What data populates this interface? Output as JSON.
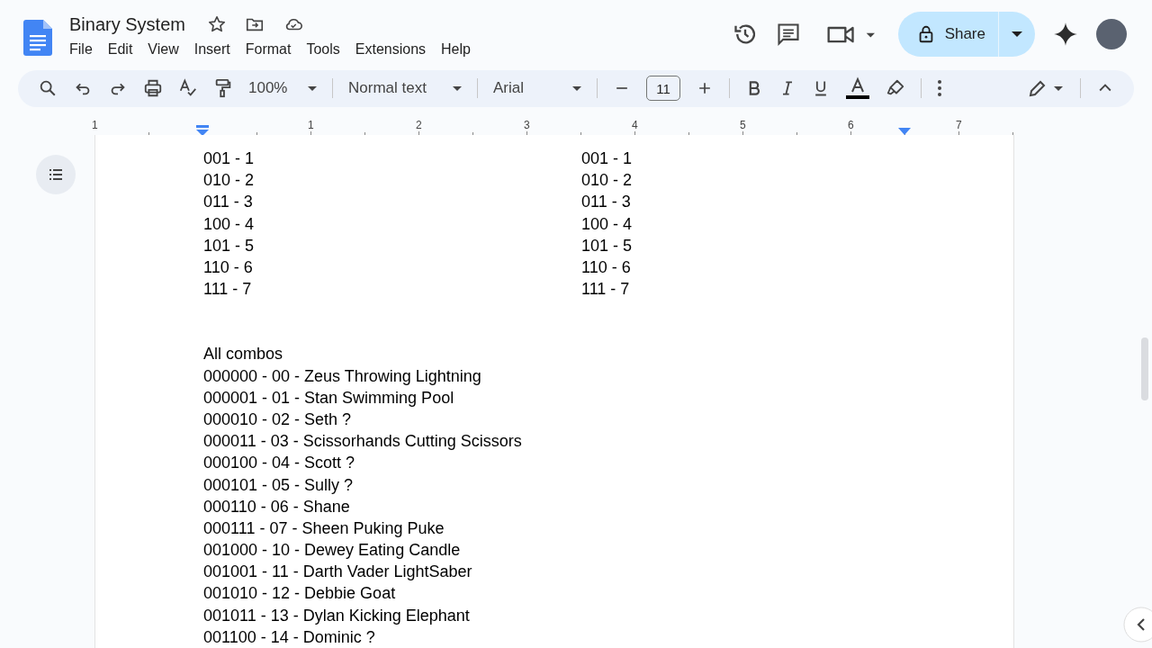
{
  "window": {
    "title": "Binary System"
  },
  "menu": [
    "File",
    "Edit",
    "View",
    "Insert",
    "Format",
    "Tools",
    "Extensions",
    "Help"
  ],
  "share": {
    "label": "Share"
  },
  "toolbar": {
    "zoom": "100%",
    "style": "Normal text",
    "font": "Arial",
    "font_size": "11"
  },
  "ruler": {
    "labels": [
      "1",
      "1",
      "2",
      "3",
      "4",
      "5",
      "6",
      "7"
    ]
  },
  "document": {
    "columns": [
      [
        "001 - 1",
        "010 - 2",
        "011 - 3",
        "100 - 4",
        "101 - 5",
        "110 - 6",
        "111 - 7"
      ],
      [
        "001 - 1",
        "010 - 2",
        "011 - 3",
        "100 - 4",
        "101 - 5",
        "110 - 6",
        "111 - 7"
      ]
    ],
    "heading": "All combos",
    "lines": [
      "000000 - 00 - Zeus Throwing Lightning",
      "000001 - 01 - Stan Swimming Pool",
      "000010 - 02 - Seth ?",
      "000011 - 03 - Scissorhands Cutting Scissors",
      "000100 - 04 - Scott ?",
      "000101 - 05 - Sully ?",
      "000110 - 06 - Shane",
      "000111 - 07 - Sheen Puking Puke",
      "001000 - 10 - Dewey Eating Candle",
      "001001 - 11 - Darth Vader LightSaber",
      "001010 - 12 - Debbie Goat",
      "001011 - 13 - Dylan Kicking Elephant",
      "001100 - 14 - Dominic ?"
    ]
  }
}
